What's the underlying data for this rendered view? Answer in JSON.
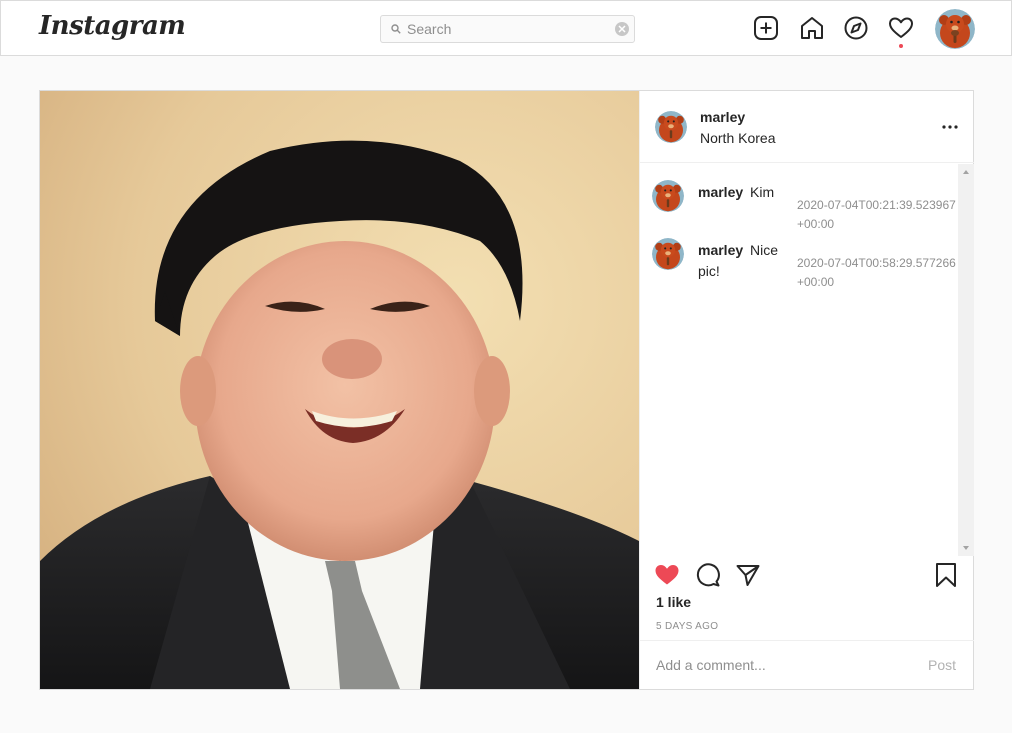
{
  "nav": {
    "logo": "Instagram",
    "search_placeholder": "Search",
    "icons": [
      "new-post-icon",
      "home-icon",
      "explore-icon",
      "activity-heart-icon"
    ],
    "notification_color": "#ed4956"
  },
  "post": {
    "author": "marley",
    "location": "North Korea",
    "comments": [
      {
        "user": "marley",
        "text": "Kim",
        "timestamp": "2020-07-04T00:21:39.523967+00:00"
      },
      {
        "user": "marley",
        "text": "Nice pic!",
        "timestamp": "2020-07-04T00:58:29.577266+00:00"
      }
    ],
    "likes": "1 like",
    "age": "5 DAYS AGO",
    "liked": true,
    "like_color": "#ed4956",
    "add_comment_placeholder": "Add a comment...",
    "post_label": "Post"
  }
}
